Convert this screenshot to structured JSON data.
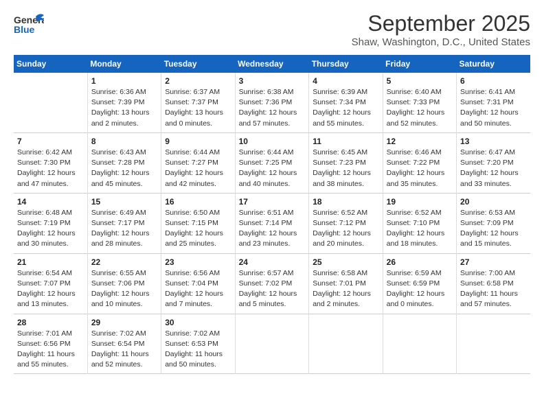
{
  "header": {
    "logo_general": "General",
    "logo_blue": "Blue",
    "title": "September 2025",
    "subtitle": "Shaw, Washington, D.C., United States"
  },
  "columns": [
    "Sunday",
    "Monday",
    "Tuesday",
    "Wednesday",
    "Thursday",
    "Friday",
    "Saturday"
  ],
  "weeks": [
    [
      {
        "day": "",
        "info": ""
      },
      {
        "day": "1",
        "info": "Sunrise: 6:36 AM\nSunset: 7:39 PM\nDaylight: 13 hours\nand 2 minutes."
      },
      {
        "day": "2",
        "info": "Sunrise: 6:37 AM\nSunset: 7:37 PM\nDaylight: 13 hours\nand 0 minutes."
      },
      {
        "day": "3",
        "info": "Sunrise: 6:38 AM\nSunset: 7:36 PM\nDaylight: 12 hours\nand 57 minutes."
      },
      {
        "day": "4",
        "info": "Sunrise: 6:39 AM\nSunset: 7:34 PM\nDaylight: 12 hours\nand 55 minutes."
      },
      {
        "day": "5",
        "info": "Sunrise: 6:40 AM\nSunset: 7:33 PM\nDaylight: 12 hours\nand 52 minutes."
      },
      {
        "day": "6",
        "info": "Sunrise: 6:41 AM\nSunset: 7:31 PM\nDaylight: 12 hours\nand 50 minutes."
      }
    ],
    [
      {
        "day": "7",
        "info": "Sunrise: 6:42 AM\nSunset: 7:30 PM\nDaylight: 12 hours\nand 47 minutes."
      },
      {
        "day": "8",
        "info": "Sunrise: 6:43 AM\nSunset: 7:28 PM\nDaylight: 12 hours\nand 45 minutes."
      },
      {
        "day": "9",
        "info": "Sunrise: 6:44 AM\nSunset: 7:27 PM\nDaylight: 12 hours\nand 42 minutes."
      },
      {
        "day": "10",
        "info": "Sunrise: 6:44 AM\nSunset: 7:25 PM\nDaylight: 12 hours\nand 40 minutes."
      },
      {
        "day": "11",
        "info": "Sunrise: 6:45 AM\nSunset: 7:23 PM\nDaylight: 12 hours\nand 38 minutes."
      },
      {
        "day": "12",
        "info": "Sunrise: 6:46 AM\nSunset: 7:22 PM\nDaylight: 12 hours\nand 35 minutes."
      },
      {
        "day": "13",
        "info": "Sunrise: 6:47 AM\nSunset: 7:20 PM\nDaylight: 12 hours\nand 33 minutes."
      }
    ],
    [
      {
        "day": "14",
        "info": "Sunrise: 6:48 AM\nSunset: 7:19 PM\nDaylight: 12 hours\nand 30 minutes."
      },
      {
        "day": "15",
        "info": "Sunrise: 6:49 AM\nSunset: 7:17 PM\nDaylight: 12 hours\nand 28 minutes."
      },
      {
        "day": "16",
        "info": "Sunrise: 6:50 AM\nSunset: 7:15 PM\nDaylight: 12 hours\nand 25 minutes."
      },
      {
        "day": "17",
        "info": "Sunrise: 6:51 AM\nSunset: 7:14 PM\nDaylight: 12 hours\nand 23 minutes."
      },
      {
        "day": "18",
        "info": "Sunrise: 6:52 AM\nSunset: 7:12 PM\nDaylight: 12 hours\nand 20 minutes."
      },
      {
        "day": "19",
        "info": "Sunrise: 6:52 AM\nSunset: 7:10 PM\nDaylight: 12 hours\nand 18 minutes."
      },
      {
        "day": "20",
        "info": "Sunrise: 6:53 AM\nSunset: 7:09 PM\nDaylight: 12 hours\nand 15 minutes."
      }
    ],
    [
      {
        "day": "21",
        "info": "Sunrise: 6:54 AM\nSunset: 7:07 PM\nDaylight: 12 hours\nand 13 minutes."
      },
      {
        "day": "22",
        "info": "Sunrise: 6:55 AM\nSunset: 7:06 PM\nDaylight: 12 hours\nand 10 minutes."
      },
      {
        "day": "23",
        "info": "Sunrise: 6:56 AM\nSunset: 7:04 PM\nDaylight: 12 hours\nand 7 minutes."
      },
      {
        "day": "24",
        "info": "Sunrise: 6:57 AM\nSunset: 7:02 PM\nDaylight: 12 hours\nand 5 minutes."
      },
      {
        "day": "25",
        "info": "Sunrise: 6:58 AM\nSunset: 7:01 PM\nDaylight: 12 hours\nand 2 minutes."
      },
      {
        "day": "26",
        "info": "Sunrise: 6:59 AM\nSunset: 6:59 PM\nDaylight: 12 hours\nand 0 minutes."
      },
      {
        "day": "27",
        "info": "Sunrise: 7:00 AM\nSunset: 6:58 PM\nDaylight: 11 hours\nand 57 minutes."
      }
    ],
    [
      {
        "day": "28",
        "info": "Sunrise: 7:01 AM\nSunset: 6:56 PM\nDaylight: 11 hours\nand 55 minutes."
      },
      {
        "day": "29",
        "info": "Sunrise: 7:02 AM\nSunset: 6:54 PM\nDaylight: 11 hours\nand 52 minutes."
      },
      {
        "day": "30",
        "info": "Sunrise: 7:02 AM\nSunset: 6:53 PM\nDaylight: 11 hours\nand 50 minutes."
      },
      {
        "day": "",
        "info": ""
      },
      {
        "day": "",
        "info": ""
      },
      {
        "day": "",
        "info": ""
      },
      {
        "day": "",
        "info": ""
      }
    ]
  ]
}
